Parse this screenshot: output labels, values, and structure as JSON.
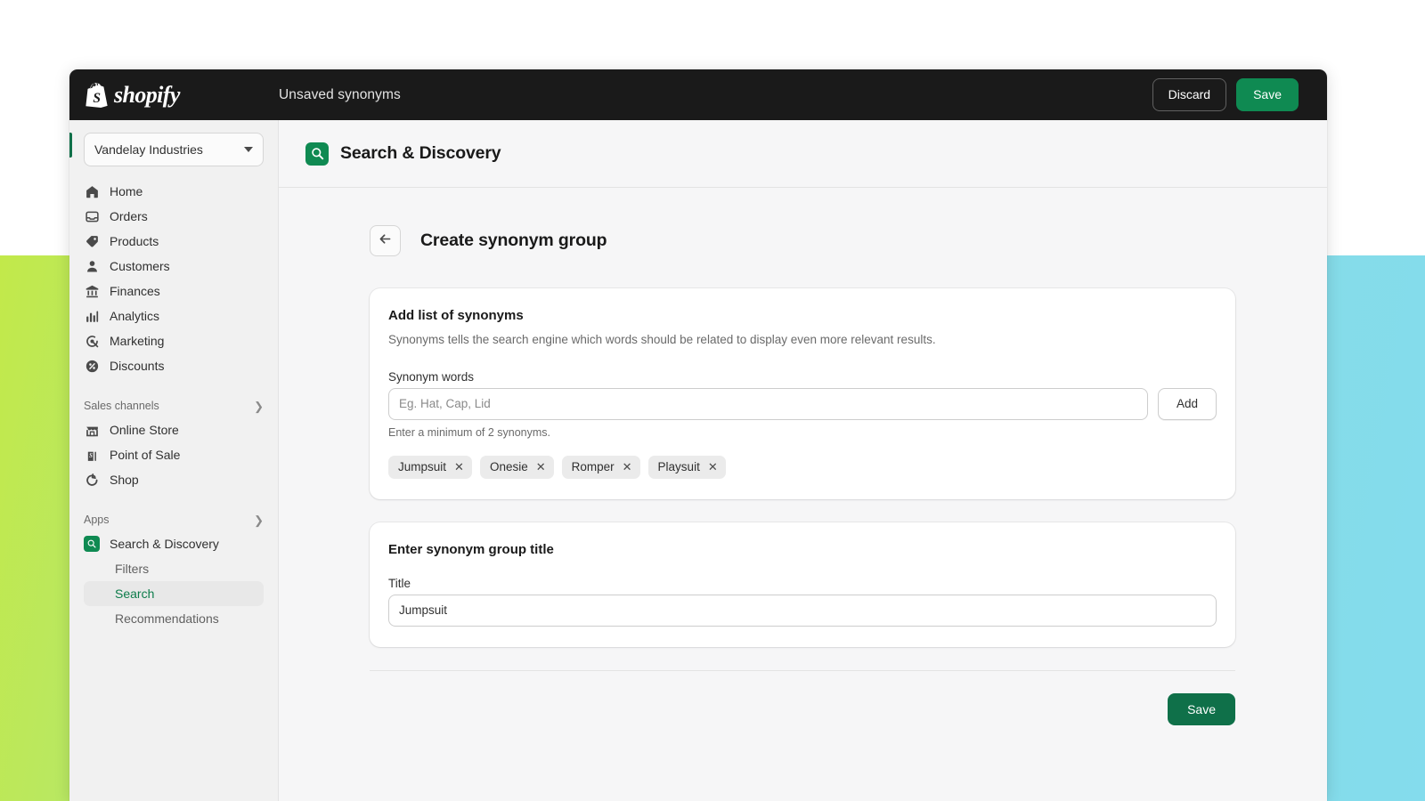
{
  "topbar": {
    "brand": "shopify",
    "brand_icon": "shopify-bag-icon",
    "title": "Unsaved synonyms",
    "discard_label": "Discard",
    "save_label": "Save",
    "save_color": "#0f8a52"
  },
  "sidebar": {
    "store_switcher": {
      "name": "Vandelay Industries",
      "icon": "chevron-down-icon"
    },
    "primary_items": [
      {
        "label": "Home",
        "icon": "home-icon"
      },
      {
        "label": "Orders",
        "icon": "orders-inbox-icon"
      },
      {
        "label": "Products",
        "icon": "product-tag-icon"
      },
      {
        "label": "Customers",
        "icon": "person-icon"
      },
      {
        "label": "Finances",
        "icon": "bank-icon"
      },
      {
        "label": "Analytics",
        "icon": "bar-chart-icon"
      },
      {
        "label": "Marketing",
        "icon": "megaphone-target-icon"
      },
      {
        "label": "Discounts",
        "icon": "discount-percent-icon"
      }
    ],
    "sections": [
      {
        "label": "Sales channels",
        "chevron": "chevron-right-icon",
        "items": [
          {
            "label": "Online Store",
            "icon": "storefront-icon"
          },
          {
            "label": "Point of Sale",
            "icon": "point-of-sale-icon"
          },
          {
            "label": "Shop",
            "icon": "shop-icon"
          }
        ]
      },
      {
        "label": "Apps",
        "chevron": "chevron-right-icon",
        "items": [
          {
            "label": "Search & Discovery",
            "icon": "search-discovery-app-icon"
          }
        ],
        "subitems": [
          {
            "label": "Filters",
            "active": false
          },
          {
            "label": "Search",
            "active": true
          },
          {
            "label": "Recommendations",
            "active": false
          }
        ]
      }
    ],
    "active_accent": "#0f7049"
  },
  "app_header": {
    "icon": "search-discovery-app-icon",
    "title": "Search & Discovery"
  },
  "page": {
    "back_icon": "arrow-left-icon",
    "title": "Create synonym group"
  },
  "synonyms_card": {
    "title": "Add list of synonyms",
    "description": "Synonyms tells the search engine which words should be related to display even more relevant results.",
    "field_label": "Synonym words",
    "input_value": "",
    "input_placeholder": "Eg. Hat, Cap, Lid",
    "add_button_label": "Add",
    "helper_text": "Enter a minimum of 2 synonyms.",
    "tags": [
      {
        "label": "Jumpsuit",
        "remove_icon": "close-icon"
      },
      {
        "label": "Onesie",
        "remove_icon": "close-icon"
      },
      {
        "label": "Romper",
        "remove_icon": "close-icon"
      },
      {
        "label": "Playsuit",
        "remove_icon": "close-icon"
      }
    ]
  },
  "title_card": {
    "title": "Enter synonym group title",
    "field_label": "Title",
    "input_value": "Jumpsuit",
    "input_placeholder": ""
  },
  "footer": {
    "save_label": "Save",
    "save_color": "#0f7049"
  }
}
